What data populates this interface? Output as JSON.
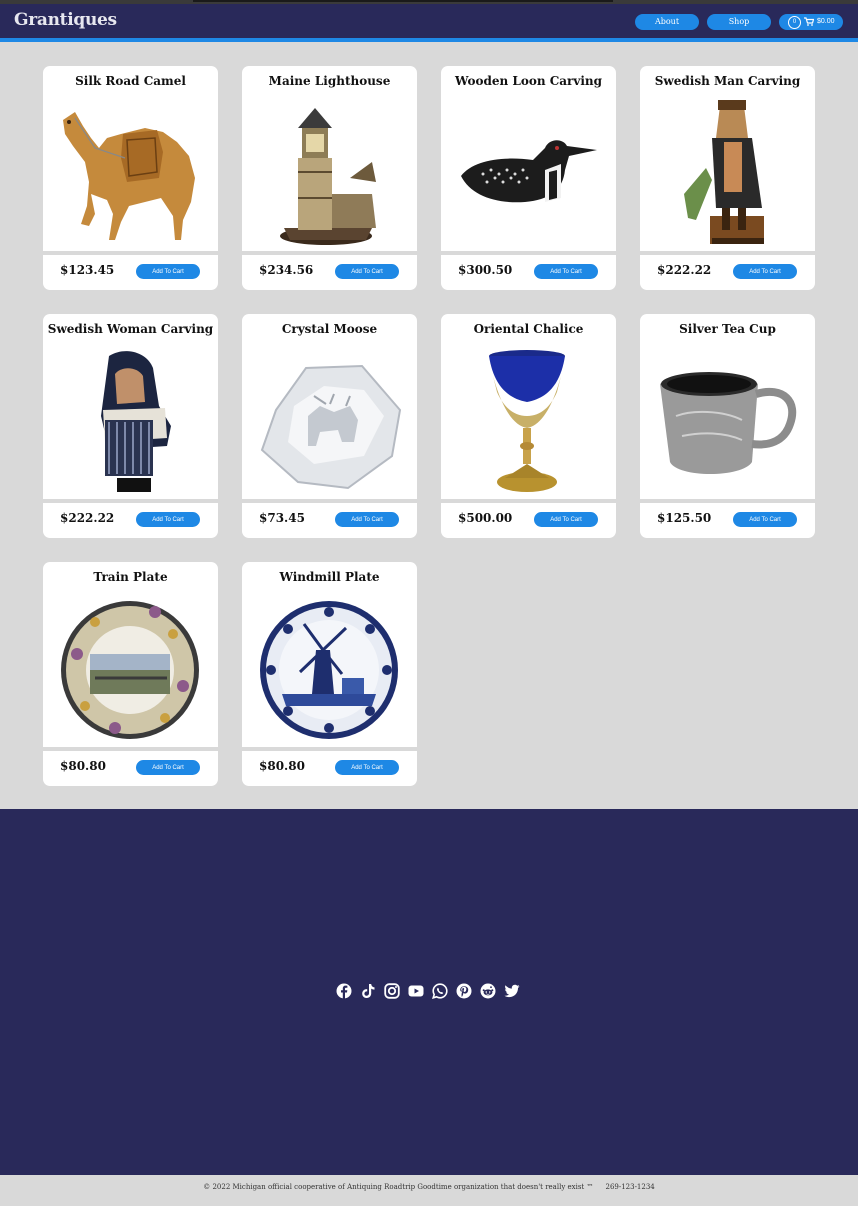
{
  "header": {
    "brand": "Grantiques",
    "nav": [
      {
        "label": "About"
      },
      {
        "label": "Shop"
      }
    ],
    "cart": {
      "count": "0",
      "total": "$0.00"
    }
  },
  "products": [
    {
      "title": "Silk Road Camel",
      "price": "$123.45",
      "button": "Add To Cart",
      "icon": "camel-carving"
    },
    {
      "title": "Maine Lighthouse",
      "price": "$234.56",
      "button": "Add To Cart",
      "icon": "lighthouse"
    },
    {
      "title": "Wooden Loon Carving",
      "price": "$300.50",
      "button": "Add To Cart",
      "icon": "loon-carving"
    },
    {
      "title": "Swedish Man Carving",
      "price": "$222.22",
      "button": "Add To Cart",
      "icon": "man-carving"
    },
    {
      "title": "Swedish Woman Carving",
      "price": "$222.22",
      "button": "Add To Cart",
      "icon": "woman-carving"
    },
    {
      "title": "Crystal Moose",
      "price": "$73.45",
      "button": "Add To Cart",
      "icon": "crystal-block"
    },
    {
      "title": "Oriental Chalice",
      "price": "$500.00",
      "button": "Add To Cart",
      "icon": "chalice"
    },
    {
      "title": "Silver Tea Cup",
      "price": "$125.50",
      "button": "Add To Cart",
      "icon": "tea-cup"
    },
    {
      "title": "Train Plate",
      "price": "$80.80",
      "button": "Add To Cart",
      "icon": "decorative-plate"
    },
    {
      "title": "Windmill Plate",
      "price": "$80.80",
      "button": "Add To Cart",
      "icon": "delft-plate"
    }
  ],
  "footer": {
    "social": [
      "facebook-icon",
      "tiktok-icon",
      "instagram-icon",
      "youtube-icon",
      "whatsapp-icon",
      "pinterest-icon",
      "reddit-icon",
      "twitter-icon"
    ],
    "copyright": "© 2022 Michigan official cooperative of Antiquing Roadtrip Goodtime organization that doesn't really exist ™",
    "phone": "269-123-1234"
  },
  "colors": {
    "navy": "#29295a",
    "accent": "#1e88e5",
    "background": "#d9d9d9"
  }
}
